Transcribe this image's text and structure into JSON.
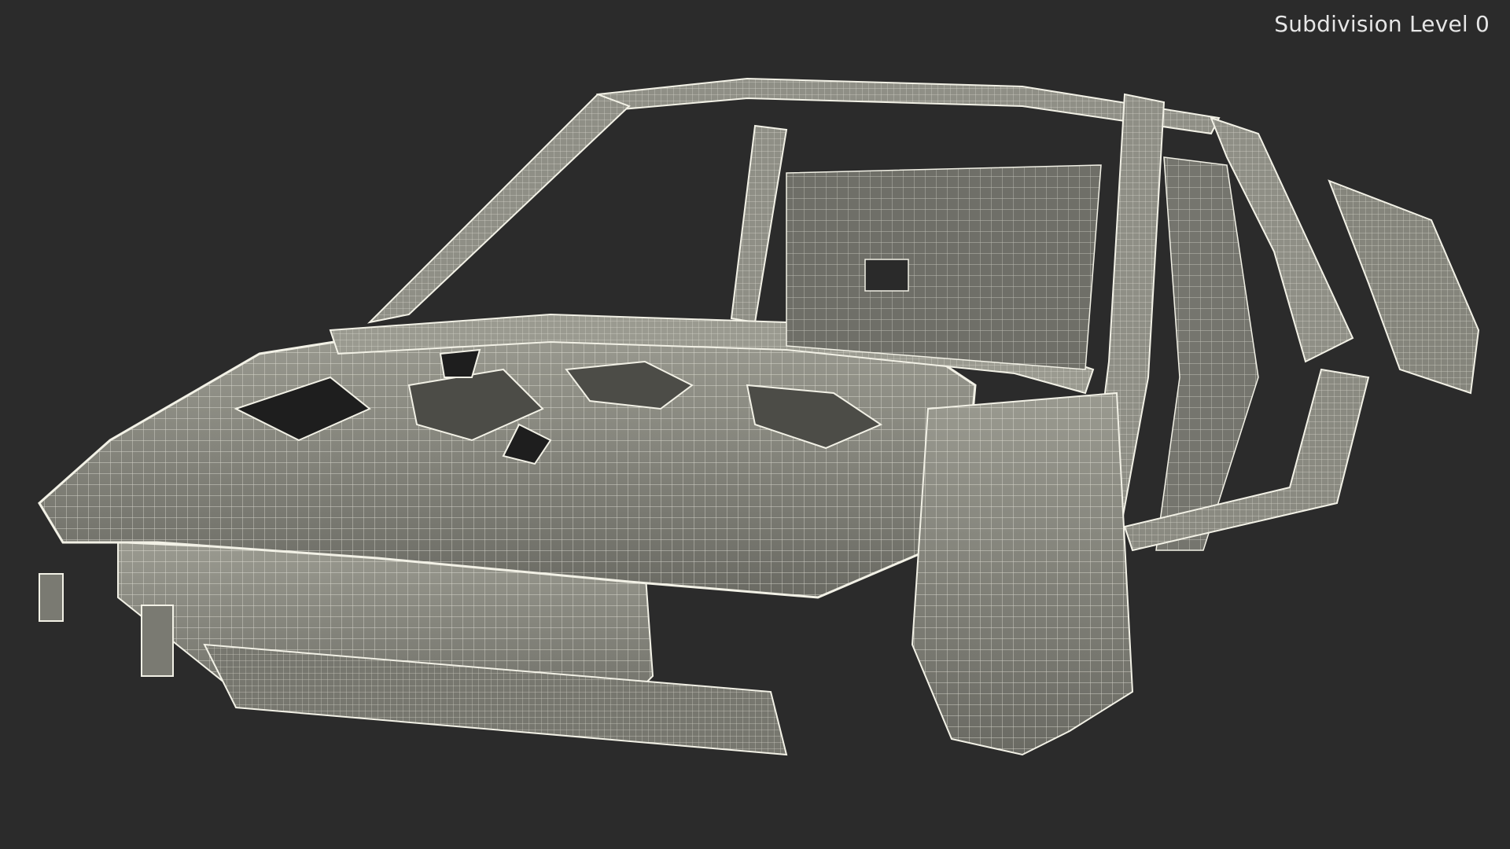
{
  "viewport": {
    "background": "#2b2b2b",
    "overlay_label": "Subdivision Level 0"
  },
  "model": {
    "subject": "car-body-in-white",
    "render_style": "wireframe-over-shaded",
    "surface_color": "#8b8b82",
    "wire_color": "#f2f1e6"
  }
}
